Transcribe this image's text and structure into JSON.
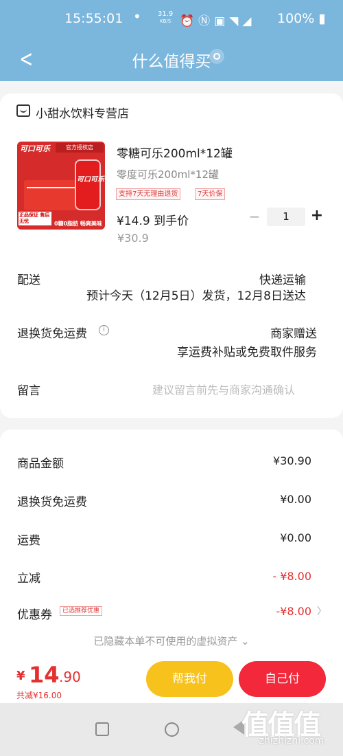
{
  "status_bar": {
    "time": "15:55:01",
    "net_speed": "31.9",
    "net_unit": "KB/S",
    "battery": "100%"
  },
  "nav": {
    "title": "什么值得买"
  },
  "shop": {
    "name": "小甜水饮料专营店"
  },
  "product": {
    "image_brand_text": "可口可乐",
    "image_auth_text": "官方授权店",
    "image_tag_1": "正品保证 售后无忧",
    "image_tag_2": "0糖0脂肪 畅爽美味",
    "title": "零糖可乐200ml*12罐",
    "spec": "零度可乐200ml*12罐",
    "badge_return": "支持7天无理由退货",
    "badge_price": "7天价保",
    "price_final": "¥14.9 到手价",
    "price_original": "¥30.9",
    "quantity": "1",
    "minus_symbol": "−",
    "plus_symbol": "+"
  },
  "delivery": {
    "label": "配送",
    "method": "快递运输",
    "estimate": "预计今天（12月5日）发货，12月8日送达"
  },
  "return_freight": {
    "label": "退换货免运费",
    "info_symbol": "i",
    "provider": "商家赠送",
    "detail": "享运费补贴或免费取件服务"
  },
  "remark": {
    "label": "留言",
    "placeholder": "建议留言前先与商家沟通确认"
  },
  "fees": {
    "goods_label": "商品金额",
    "goods_value": "¥30.90",
    "return_label": "退换货免运费",
    "return_value": "¥0.00",
    "shipping_label": "运费",
    "shipping_value": "¥0.00",
    "discount_label": "立减",
    "discount_value": "- ¥8.00",
    "coupon_label": "优惠券",
    "coupon_tag": "已选推荐优惠",
    "coupon_value": "-¥8.00",
    "coupon_arrow": "〉",
    "hidden_assets": "已隐藏本单不可使用的虚拟资产 ⌄"
  },
  "checkout": {
    "currency": "¥",
    "total_int": "14",
    "total_dec": ".90",
    "saved": "共减¥16.00",
    "help_pay_label": "帮我付",
    "self_pay_label": "自己付"
  },
  "watermark": {
    "glyphs": "值值值",
    "site": "zhizhizhi.com"
  },
  "colors": {
    "header_bg": "#7bb6dd",
    "accent_red": "#e53030",
    "help_btn": "#f8c21d",
    "pay_btn": "#f3283a"
  }
}
